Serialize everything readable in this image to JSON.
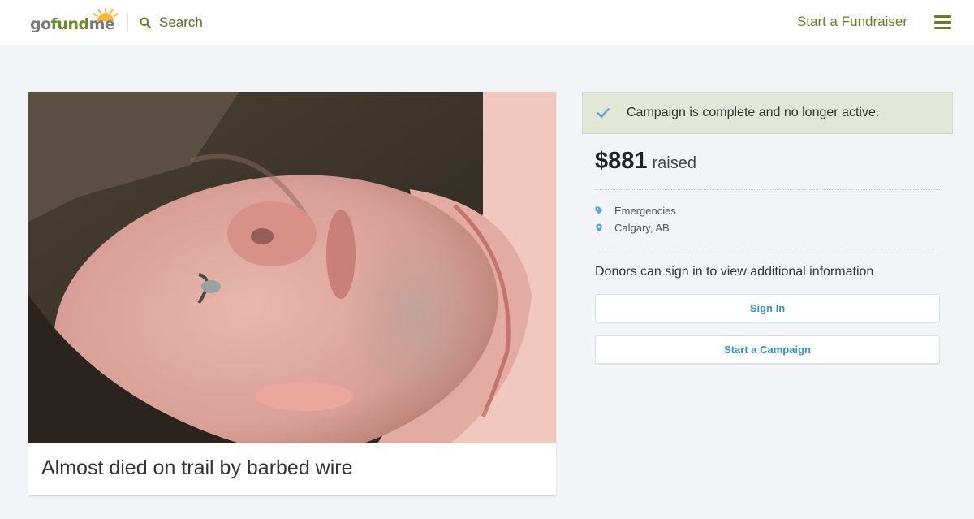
{
  "header": {
    "logo": {
      "go": "go",
      "fund": "fund",
      "me": "me"
    },
    "search_label": "Search",
    "start_fundraiser": "Start a Fundraiser"
  },
  "campaign": {
    "title": "Almost died on trail by barbed wire",
    "status": "Campaign is complete and no longer active.",
    "amount": "$881",
    "raised_label": "raised",
    "category": "Emergencies",
    "location": "Calgary, AB",
    "donors_note": "Donors can sign in to view additional information"
  },
  "actions": {
    "sign_in": "Sign In",
    "start_campaign": "Start a Campaign"
  },
  "icons": {
    "search": "search-icon",
    "menu": "hamburger-menu-icon",
    "check": "check-icon",
    "tag": "tag-icon",
    "location": "map-pin-icon"
  },
  "colors": {
    "brand_green": "#6b7a2a",
    "link_blue": "#3a8fc4",
    "check_blue": "#5aa7d8",
    "banner_bg": "#e3e7d8",
    "page_bg": "#f2f4f8"
  }
}
